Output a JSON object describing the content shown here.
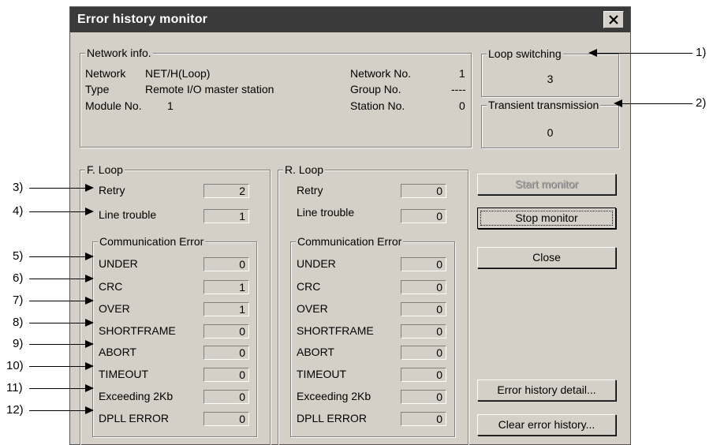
{
  "dialog": {
    "title": "Error history monitor",
    "close_icon": "close-x-icon"
  },
  "network_info": {
    "label": "Network info.",
    "network_label": "Network",
    "network_value": "NET/H(Loop)",
    "type_label": "Type",
    "type_value": "Remote I/O master station",
    "module_label": "Module No.",
    "module_value": "1",
    "network_no_label": "Network No.",
    "network_no_value": "1",
    "group_no_label": "Group No.",
    "group_no_value": "----",
    "station_no_label": "Station No.",
    "station_no_value": "0"
  },
  "loop_switching": {
    "label": "Loop switching",
    "value": "3"
  },
  "transient_transmission": {
    "label": "Transient transmission",
    "value": "0"
  },
  "f_loop": {
    "label": "F. Loop",
    "retry_label": "Retry",
    "retry_value": "2",
    "line_trouble_label": "Line trouble",
    "line_trouble_value": "1",
    "comm_error_label": "Communication Error",
    "errors": [
      {
        "label": "UNDER",
        "value": "0"
      },
      {
        "label": "CRC",
        "value": "1"
      },
      {
        "label": "OVER",
        "value": "1"
      },
      {
        "label": "SHORTFRAME",
        "value": "0"
      },
      {
        "label": "ABORT",
        "value": "0"
      },
      {
        "label": "TIMEOUT",
        "value": "0"
      },
      {
        "label": "Exceeding 2Kb",
        "value": "0"
      },
      {
        "label": "DPLL ERROR",
        "value": "0"
      }
    ]
  },
  "r_loop": {
    "label": "R. Loop",
    "retry_label": "Retry",
    "retry_value": "0",
    "line_trouble_label": "Line trouble",
    "line_trouble_value": "0",
    "comm_error_label": "Communication Error",
    "errors": [
      {
        "label": "UNDER",
        "value": "0"
      },
      {
        "label": "CRC",
        "value": "0"
      },
      {
        "label": "OVER",
        "value": "0"
      },
      {
        "label": "SHORTFRAME",
        "value": "0"
      },
      {
        "label": "ABORT",
        "value": "0"
      },
      {
        "label": "TIMEOUT",
        "value": "0"
      },
      {
        "label": "Exceeding 2Kb",
        "value": "0"
      },
      {
        "label": "DPLL ERROR",
        "value": "0"
      }
    ]
  },
  "buttons": {
    "start_monitor": "Start monitor",
    "stop_monitor": "Stop monitor",
    "close": "Close",
    "error_history_detail": "Error history detail...",
    "clear_error_history": "Clear error history..."
  },
  "callouts": [
    "1)",
    "2)",
    "3)",
    "4)",
    "5)",
    "6)",
    "7)",
    "8)",
    "9)",
    "10)",
    "11)",
    "12)"
  ]
}
